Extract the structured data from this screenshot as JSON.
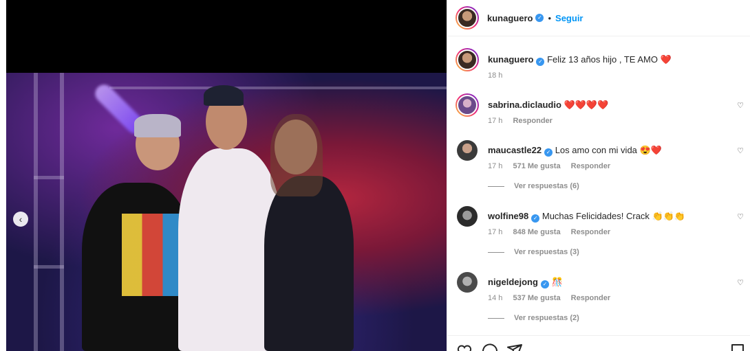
{
  "header": {
    "username": "kunaguero",
    "dot": "•",
    "follow_label": "Seguir"
  },
  "caption": {
    "username": "kunaguero",
    "text": "Feliz 13 años hijo , TE AMO ❤️",
    "time": "18 h"
  },
  "comments": [
    {
      "username": "sabrina.diclaudio",
      "verified": false,
      "text": "❤️❤️❤️❤️",
      "time": "17 h",
      "likes": "",
      "reply_label": "Responder",
      "replies_label": ""
    },
    {
      "username": "maucastle22",
      "verified": true,
      "text": "Los amo con mi vida 😍❤️",
      "time": "17 h",
      "likes": "571 Me gusta",
      "reply_label": "Responder",
      "replies_label": "Ver respuestas (6)"
    },
    {
      "username": "wolfine98",
      "verified": true,
      "text": "Muchas Felicidades! Crack 👏👏👏",
      "time": "17 h",
      "likes": "848 Me gusta",
      "reply_label": "Responder",
      "replies_label": "Ver respuestas (3)"
    },
    {
      "username": "nigeldejong",
      "verified": true,
      "text": "🎊",
      "time": "14 h",
      "likes": "537 Me gusta",
      "reply_label": "Responder",
      "replies_label": "Ver respuestas (2)"
    }
  ],
  "icons": {
    "verified": "verified-badge-icon",
    "heart": "heart-icon",
    "comment": "comment-icon",
    "share": "share-icon",
    "save": "bookmark-icon",
    "prev": "chevron-left-icon"
  },
  "colors": {
    "link": "#0095f6",
    "verified": "#3897f0",
    "muted": "#8e8e8e"
  }
}
